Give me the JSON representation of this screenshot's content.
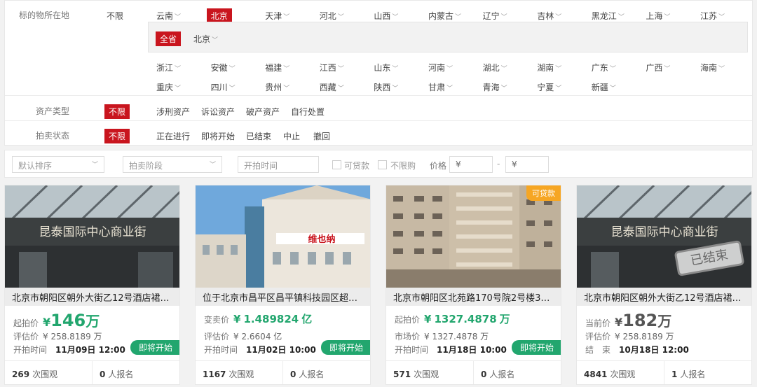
{
  "filters": {
    "location": {
      "label": "标的物所在地",
      "unlimited": "不限",
      "row1": [
        "云南",
        "北京",
        "天津",
        "河北",
        "山西",
        "内蒙古",
        "辽宁",
        "吉林",
        "黑龙江",
        "上海",
        "江苏"
      ],
      "selected": "北京",
      "sub_all": "全省",
      "sub_city": "北京",
      "row2": [
        "浙江",
        "安徽",
        "福建",
        "江西",
        "山东",
        "河南",
        "湖北",
        "湖南",
        "广东",
        "广西",
        "海南"
      ],
      "row3": [
        "重庆",
        "四川",
        "贵州",
        "西藏",
        "陕西",
        "甘肃",
        "青海",
        "宁夏",
        "新疆"
      ]
    },
    "asset_type": {
      "label": "资产类型",
      "unlimited": "不限",
      "options": [
        "涉刑资产",
        "诉讼资产",
        "破产资产",
        "自行处置"
      ]
    },
    "auction_status": {
      "label": "拍卖状态",
      "unlimited": "不限",
      "options": [
        "正在进行",
        "即将开始",
        "已结束",
        "中止",
        "撤回"
      ]
    }
  },
  "sortbar": {
    "sort_default": "默认排序",
    "auction_stage": "拍卖阶段",
    "start_time_placeholder": "开拍时间",
    "loanable": "可贷款",
    "no_purchase_limit": "不限购",
    "price_label": "价格",
    "price_min": "¥",
    "price_max": "¥",
    "dash": "-"
  },
  "cards": [
    {
      "title": "北京市朝阳区朝外大街乙12号酒店裙…",
      "price_label": "起拍价",
      "price_currency": "¥",
      "price_value": "146",
      "price_unit": "万",
      "eval_label": "评估价",
      "eval_value": "¥ 258.8189 万",
      "time_label": "开拍时间",
      "time_value": "11月09日 12:00",
      "status_badge": "即将开始",
      "views": "269",
      "views_label": "次围观",
      "signups": "0",
      "signups_label": "人报名",
      "sign_text": "昆泰国际中心商业街"
    },
    {
      "title": "位于北京市昌平区昌平镇科技园区超前…",
      "price_label": "变卖价",
      "price_currency": "¥",
      "price_value": "1.489824",
      "price_unit": "亿",
      "eval_label": "评估价",
      "eval_value": "¥ 2.6604 亿",
      "time_label": "开拍时间",
      "time_value": "11月02日 10:00",
      "status_badge": "即将开始",
      "views": "1167",
      "views_label": "次围观",
      "signups": "0",
      "signups_label": "人报名",
      "sign_text": "维也纳"
    },
    {
      "title": "北京市朝阳区北苑路170号院2号楼3层…",
      "price_label": "起拍价",
      "price_currency": "¥",
      "price_value": "1327.4878",
      "price_unit": "万",
      "eval_label": "市场价",
      "eval_value": "¥ 1327.4878 万",
      "time_label": "开拍时间",
      "time_value": "11月18日 10:00",
      "status_badge": "即将开始",
      "views": "571",
      "views_label": "次围观",
      "signups": "0",
      "signups_label": "人报名",
      "loan_tag": "可贷款"
    },
    {
      "title": "北京市朝阳区朝外大街乙12号酒店裙…",
      "price_label": "当前价",
      "price_currency": "¥",
      "price_value": "182",
      "price_unit": "万",
      "eval_label": "评估价",
      "eval_value": "¥ 258.8189 万",
      "time_label": "结　束",
      "time_value": "10月18日 12:00",
      "views": "4841",
      "views_label": "次围观",
      "signups": "1",
      "signups_label": "人报名",
      "ended_stamp": "已结束",
      "sign_text": "昆泰国际中心商业街"
    }
  ],
  "colors": {
    "accent_red": "#c9151e",
    "price_green": "#22a66e",
    "loan_orange": "#f6a623"
  }
}
